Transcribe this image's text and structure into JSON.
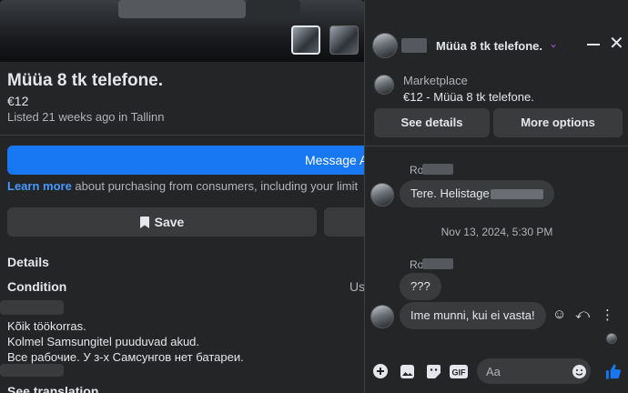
{
  "listing": {
    "title": "Müüa 8 tk telefone.",
    "price": "€12",
    "listed": "Listed 21 weeks ago in Tallinn",
    "message_button": "Message A",
    "learn_link": "Learn more",
    "learn_rest": " about purchasing from consumers, including your limit",
    "save_label": "Save",
    "details_heading": "Details",
    "condition_label": "Condition",
    "condition_value": "Us",
    "description": [
      "Kõik töökorras.",
      "Kolmel Samsungitel puuduvad akud.",
      "Все рабочие. У з-х Самсунгов нет батареи."
    ],
    "see_translation": "See translation"
  },
  "chat": {
    "title": "Müüa 8 tk telefone.",
    "marketplace_label": "Marketplace",
    "marketplace_item": "€12 - Müüa 8 tk telefone.",
    "see_details": "See details",
    "more_options": "More options",
    "messages": [
      {
        "sender": "Ro",
        "text": "Tere. Helistage"
      },
      {
        "sender": "Ro",
        "text": "???"
      },
      {
        "text": "Ime munni, kui ei vasta!"
      }
    ],
    "timestamp": "Nov 13, 2024, 5:30 PM",
    "composer_placeholder": "Aa"
  },
  "icons": [
    "bookmark-icon",
    "chevron-down-icon",
    "minimize-icon",
    "close-icon",
    "emoji-icon",
    "reply-icon",
    "more-icon",
    "plus-icon",
    "photo-icon",
    "sticker-icon",
    "gif-icon",
    "thumbs-up-icon"
  ],
  "colors": {
    "accent": "#1877f2",
    "link": "#4599ff",
    "panel": "#242526",
    "bubble": "#3a3b3c",
    "chevron": "#a855f7"
  }
}
